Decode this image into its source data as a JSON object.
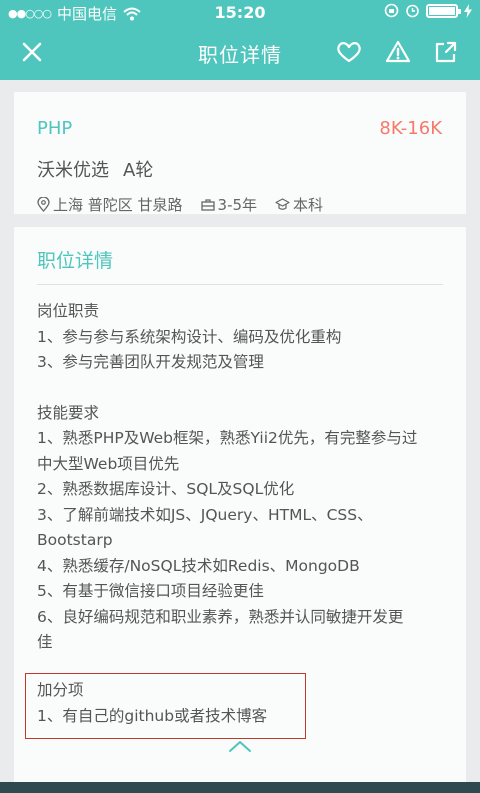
{
  "status_bar": {
    "signal": "●●○○○",
    "carrier": "中国电信",
    "time": "15:20"
  },
  "nav": {
    "title": "职位详情",
    "icons": [
      "close-icon",
      "heart-icon",
      "alert-icon",
      "share-icon"
    ]
  },
  "job": {
    "title": "PHP",
    "salary": "8K-16K",
    "company": "沃米优选",
    "round": "A轮",
    "location": "上海 普陀区 甘泉路",
    "experience": "3-5年",
    "education": "本科"
  },
  "detail": {
    "heading": "职位详情",
    "responsibilities_title": "岗位职责",
    "responsibilities": [
      "1、参与参与系统架构设计、编码及优化重构",
      "3、参与完善团队开发规范及管理"
    ],
    "skills_title": "技能要求",
    "skills": [
      "1、熟悉PHP及Web框架，熟悉Yii2优先，有完整参与过",
      "中大型Web项目优先",
      "2、熟悉数据库设计、SQL及SQL优化",
      "3、了解前端技术如JS、JQuery、HTML、CSS、",
      "Bootstarp",
      "4、熟悉缓存/NoSQL技术如Redis、MongoDB",
      "5、有基于微信接口项目经验更佳",
      "6、良好编码规范和职业素养，熟悉并认同敏捷开发更",
      "佳"
    ],
    "bonus_title": "加分项",
    "bonus": [
      "1、有自己的github或者技术博客"
    ]
  },
  "colors": {
    "accent": "#4ec6bd",
    "salary": "#f57a6b",
    "highlight_box": "#c0392b"
  }
}
